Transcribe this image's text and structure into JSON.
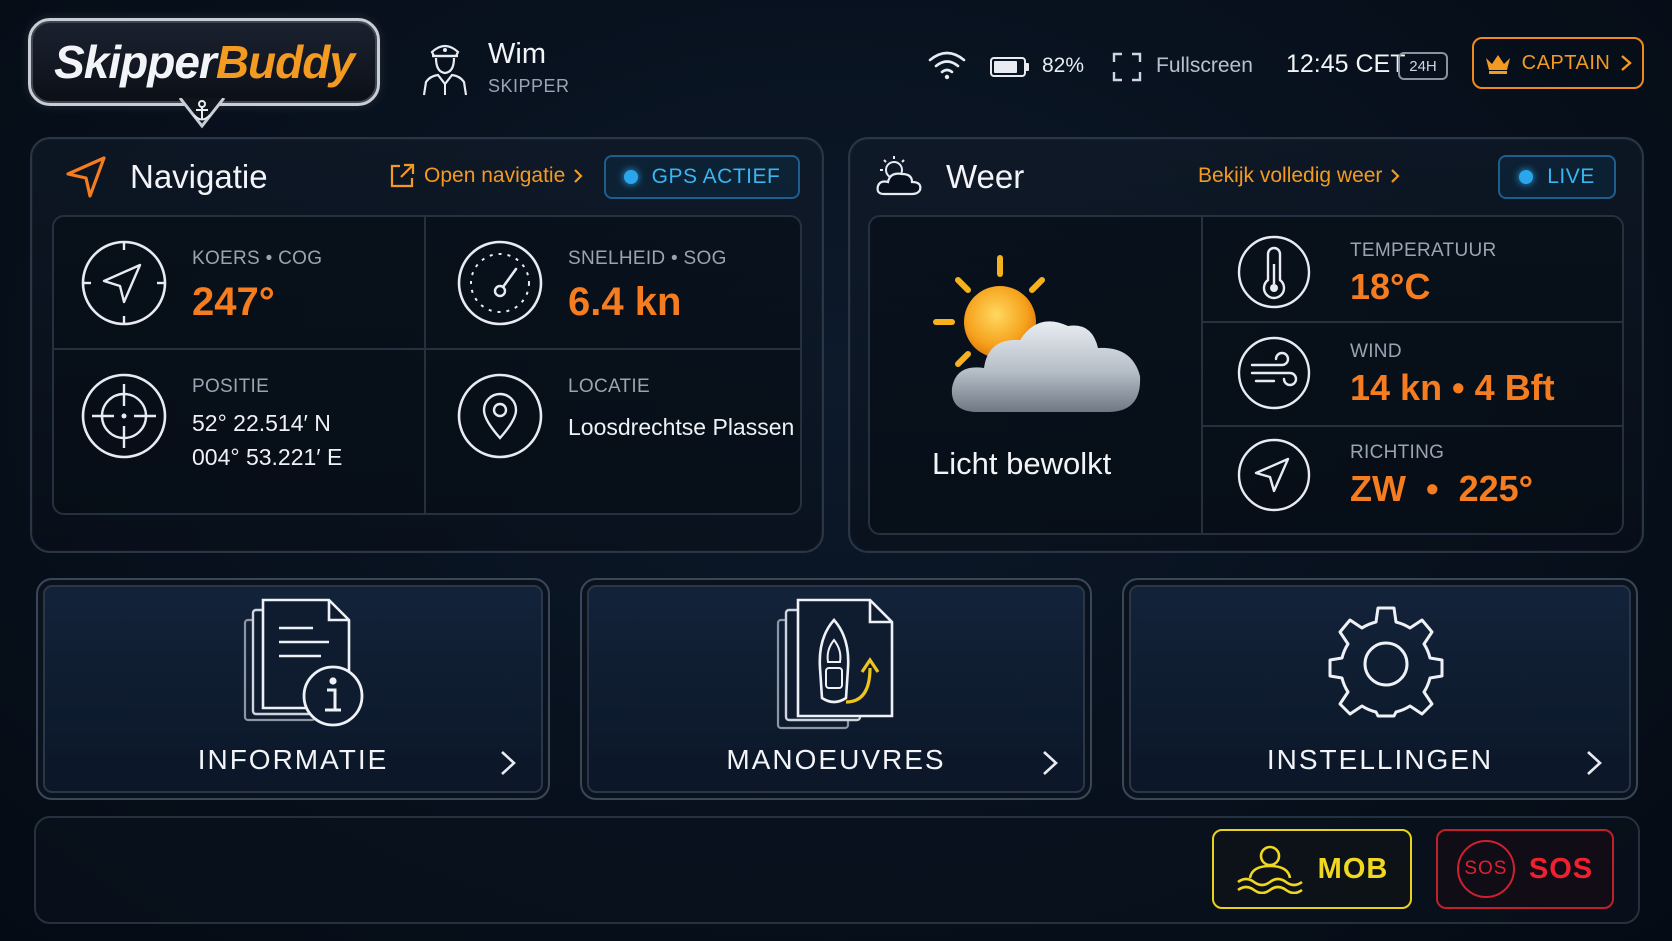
{
  "header": {
    "logo": {
      "part1": "Skipper",
      "part2": "Buddy"
    },
    "user": {
      "name": "Wim",
      "role": "SKIPPER",
      "icon": "captain-avatar-icon"
    },
    "status": {
      "wifi_icon": "wifi-icon",
      "battery_icon": "battery-icon",
      "battery_percent": "82%",
      "battery_level": 0.82,
      "fullscreen_label": "Fullscreen",
      "time": "12:45 CET",
      "time_format": "24H"
    },
    "captain_button": {
      "label": "CAPTAIN",
      "icon": "crown-icon"
    }
  },
  "navigation": {
    "title": "Navigatie",
    "open_link": "Open navigatie",
    "gps_status": "GPS ACTIEF",
    "course": {
      "label": "KOERS • COG",
      "value": "247°"
    },
    "speed": {
      "label": "SNELHEID • SOG",
      "value": "6.4 kn"
    },
    "position": {
      "label": "POSITIE",
      "lat": "52° 22.514′ N",
      "lon": "004° 53.221′ E"
    },
    "location": {
      "label": "LOCATIE",
      "value": "Loosdrechtse Plassen"
    }
  },
  "weather": {
    "title": "Weer",
    "full_link": "Bekijk volledig weer",
    "live_status": "LIVE",
    "condition": "Licht bewolkt",
    "temperature": {
      "label": "TEMPERATUUR",
      "value": "18°C"
    },
    "wind": {
      "label": "WIND",
      "value": "14 kn • 4 Bft"
    },
    "direction": {
      "label": "RICHTING",
      "value": "ZW  •  225°"
    }
  },
  "tiles": [
    {
      "label": "INFORMATIE",
      "icon": "document-info-icon"
    },
    {
      "label": "MANOEUVRES",
      "icon": "boat-maneuver-icon"
    },
    {
      "label": "INSTELLINGEN",
      "icon": "gear-icon"
    }
  ],
  "emergency": {
    "mob_label": "MOB",
    "sos_label": "SOS",
    "sos_ring_text": "SOS"
  },
  "colors": {
    "accent": "#f39a22",
    "value_orange": "#f57c1f",
    "status_blue": "#2aa6ec",
    "mob_yellow": "#e8d21c",
    "sos_red": "#d02030"
  }
}
